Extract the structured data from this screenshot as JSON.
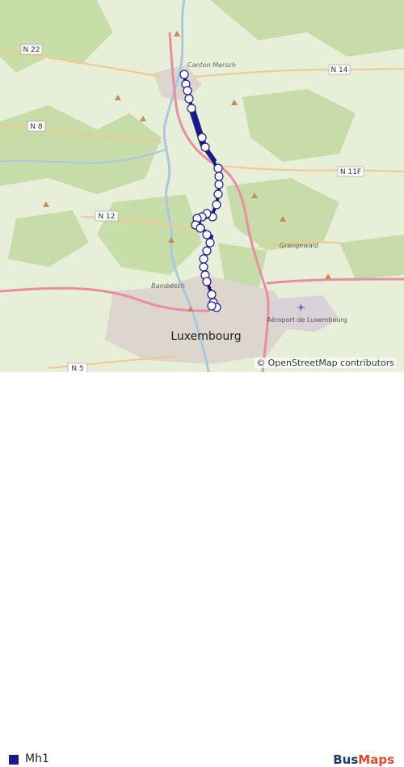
{
  "map": {
    "road_labels": [
      "N 22",
      "N 14",
      "N 8",
      "N 11F",
      "N 12",
      "N 5"
    ],
    "place_labels": [
      "Canton Mersch",
      "Grengewald",
      "Bambësch",
      "Aéroport de Luxembourg"
    ],
    "city": "Luxembourg",
    "attribution": "© OpenStreetMap contributors",
    "route_color": "#1a1a8c"
  },
  "legend": {
    "route_name": "Mh1"
  },
  "brand": {
    "part1": "Bus",
    "part2": "Maps"
  }
}
